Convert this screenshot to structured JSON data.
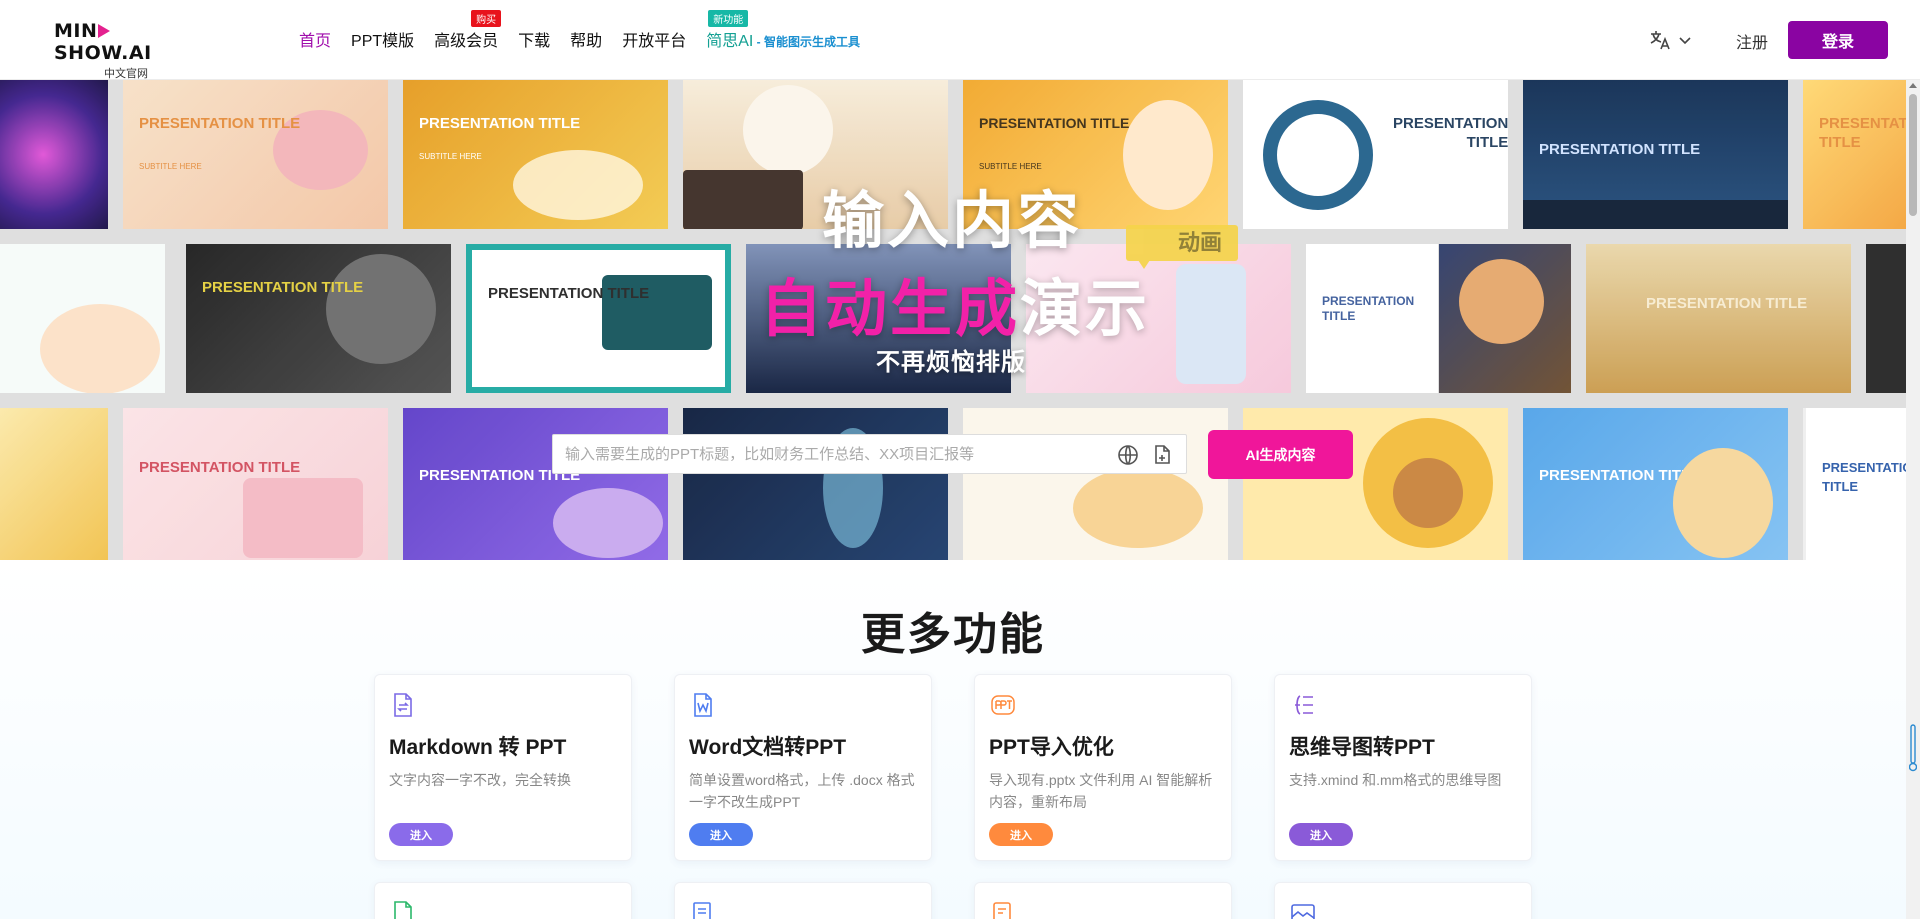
{
  "header": {
    "logo_text_1": "MIN",
    "logo_text_2": "SHOW.",
    "logo_text_3": "AI",
    "logo_sub": "中文官网",
    "nav": [
      {
        "label": "首页",
        "active": true
      },
      {
        "label": "PPT模版"
      },
      {
        "label": "高级会员",
        "badge": "购买"
      },
      {
        "label": "下载"
      },
      {
        "label": "帮助"
      },
      {
        "label": "开放平台"
      }
    ],
    "jiansi": {
      "label": "简思AI",
      "sub": " - 智能图示生成工具",
      "badge": "新功能"
    },
    "lang_icon": "translate-icon",
    "register": "注册",
    "login": "登录"
  },
  "hero": {
    "title1": "输入内容",
    "title2_pink": "自动生成",
    "title2_white": "演示",
    "anim_badge": "动画",
    "subtitle": "不再烦恼排版",
    "search_placeholder": "输入需要生成的PPT标题，比如财务工作总结、XX项目汇报等",
    "search_value": "",
    "ai_button": "AI生成内容",
    "templates": [
      {
        "title": "PRESENTATION TITLE",
        "subtitle": "SUBTITLE HERE"
      }
    ]
  },
  "features": {
    "title": "更多功能",
    "cards": [
      {
        "name": "Markdown 转 PPT",
        "desc": "文字内容一字不改，完全转换",
        "button": "进入",
        "color": "#8a6bea",
        "icon": "markdown-file-icon"
      },
      {
        "name": "Word文档转PPT",
        "desc": "简单设置word格式，上传 .docx 格式一字不改生成PPT",
        "button": "进入",
        "color": "#4f7df0",
        "icon": "word-file-icon"
      },
      {
        "name": "PPT导入优化",
        "desc": "导入现有.pptx 文件利用 AI 智能解析内容，重新布局",
        "button": "进入",
        "color": "#ff8a3d",
        "icon": "ppt-icon"
      },
      {
        "name": "思维导图转PPT",
        "desc": "支持.xmind 和.mm格式的思维导图",
        "button": "进入",
        "color": "#8a5ad8",
        "icon": "mindmap-icon"
      }
    ]
  }
}
